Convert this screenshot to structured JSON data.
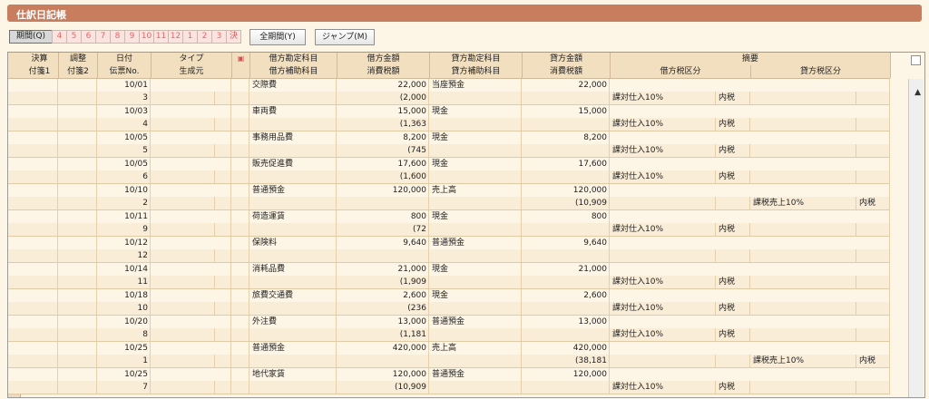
{
  "title": "仕訳日記帳",
  "toolbar": {
    "period": "期間(Q)",
    "months": [
      "4",
      "5",
      "6",
      "7",
      "8",
      "9",
      "10",
      "11",
      "12",
      "1",
      "2",
      "3",
      "決"
    ],
    "all": "全期間(Y)",
    "jump": "ジャンプ(M)"
  },
  "headers": {
    "r1": [
      "決算",
      "調整",
      "日付",
      "タイプ",
      "借方勘定科目",
      "借方金額",
      "貸方勘定科目",
      "貸方金額",
      "摘要"
    ],
    "r2": [
      "付箋1",
      "付箋2",
      "伝票No.",
      "生成元",
      "借方補助科目",
      "消費税額",
      "貸方補助科目",
      "消費税額",
      "借方税区分",
      "貸方税区分"
    ]
  },
  "rows": [
    {
      "date": "10/01",
      "no": "3",
      "dAcct": "交際費",
      "dAmt": "22,000",
      "dTax": "(2,000",
      "cAcct": "当座預金",
      "cAmt": "22,000",
      "cTax": "",
      "dTC": "課対仕入10%",
      "dTI": "内税",
      "cTC": "",
      "cTI": ""
    },
    {
      "date": "10/03",
      "no": "4",
      "dAcct": "車両費",
      "dAmt": "15,000",
      "dTax": "(1,363",
      "cAcct": "現金",
      "cAmt": "15,000",
      "cTax": "",
      "dTC": "課対仕入10%",
      "dTI": "内税",
      "cTC": "",
      "cTI": ""
    },
    {
      "date": "10/05",
      "no": "5",
      "dAcct": "事務用品費",
      "dAmt": "8,200",
      "dTax": "(745",
      "cAcct": "現金",
      "cAmt": "8,200",
      "cTax": "",
      "dTC": "課対仕入10%",
      "dTI": "内税",
      "cTC": "",
      "cTI": ""
    },
    {
      "date": "10/05",
      "no": "6",
      "dAcct": "販売促進費",
      "dAmt": "17,600",
      "dTax": "(1,600",
      "cAcct": "現金",
      "cAmt": "17,600",
      "cTax": "",
      "dTC": "課対仕入10%",
      "dTI": "内税",
      "cTC": "",
      "cTI": ""
    },
    {
      "date": "10/10",
      "no": "2",
      "dAcct": "普通預金",
      "dAmt": "120,000",
      "dTax": "",
      "cAcct": "売上高",
      "cAmt": "120,000",
      "cTax": "(10,909",
      "dTC": "",
      "dTI": "",
      "cTC": "課税売上10%",
      "cTI": "内税"
    },
    {
      "date": "10/11",
      "no": "9",
      "dAcct": "荷造運賃",
      "dAmt": "800",
      "dTax": "(72",
      "cAcct": "現金",
      "cAmt": "800",
      "cTax": "",
      "dTC": "課対仕入10%",
      "dTI": "内税",
      "cTC": "",
      "cTI": ""
    },
    {
      "date": "10/12",
      "no": "12",
      "dAcct": "保険料",
      "dAmt": "9,640",
      "dTax": "",
      "cAcct": "普通預金",
      "cAmt": "9,640",
      "cTax": "",
      "dTC": "",
      "dTI": "",
      "cTC": "",
      "cTI": ""
    },
    {
      "date": "10/14",
      "no": "11",
      "dAcct": "消耗品費",
      "dAmt": "21,000",
      "dTax": "(1,909",
      "cAcct": "現金",
      "cAmt": "21,000",
      "cTax": "",
      "dTC": "課対仕入10%",
      "dTI": "内税",
      "cTC": "",
      "cTI": ""
    },
    {
      "date": "10/18",
      "no": "10",
      "dAcct": "旅費交通費",
      "dAmt": "2,600",
      "dTax": "(236",
      "cAcct": "現金",
      "cAmt": "2,600",
      "cTax": "",
      "dTC": "課対仕入10%",
      "dTI": "内税",
      "cTC": "",
      "cTI": ""
    },
    {
      "date": "10/20",
      "no": "8",
      "dAcct": "外注費",
      "dAmt": "13,000",
      "dTax": "(1,181",
      "cAcct": "普通預金",
      "cAmt": "13,000",
      "cTax": "",
      "dTC": "課対仕入10%",
      "dTI": "内税",
      "cTC": "",
      "cTI": ""
    },
    {
      "date": "10/25",
      "no": "1",
      "dAcct": "普通預金",
      "dAmt": "420,000",
      "dTax": "",
      "cAcct": "売上高",
      "cAmt": "420,000",
      "cTax": "(38,181",
      "dTC": "",
      "dTI": "",
      "cTC": "課税売上10%",
      "cTI": "内税"
    },
    {
      "date": "10/25",
      "no": "7",
      "dAcct": "地代家賃",
      "dAmt": "120,000",
      "dTax": "(10,909",
      "cAcct": "普通預金",
      "cAmt": "120,000",
      "cTax": "",
      "dTC": "課対仕入10%",
      "dTI": "内税",
      "cTC": "",
      "cTI": ""
    }
  ]
}
